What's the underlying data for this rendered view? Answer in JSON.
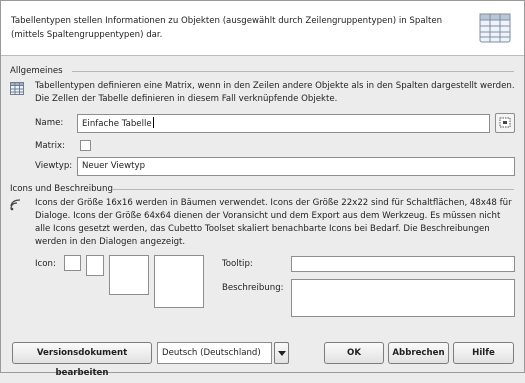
{
  "header": {
    "text": "Tabellentypen stellen Informationen zu Objekten (ausgewählt durch Zeilengruppentypen) in Spalten (mittels Spaltengruppentypen) dar."
  },
  "general": {
    "title": "Allgemeines",
    "description": "Tabellentypen definieren eine Matrix, wenn in den Zeilen andere Objekte als in den Spalten dargestellt werden. Die Zellen der Tabelle definieren in diesem Fall verknüpfende Objekte.",
    "name_label": "Name:",
    "name_value": "Einfache Tabelle",
    "matrix_label": "Matrix:",
    "viewtype_label": "Viewtyp:",
    "viewtype_value": "Neuer Viewtyp"
  },
  "icons": {
    "title": "Icons und Beschreibung",
    "description": "Icons der Größe 16x16 werden in Bäumen verwendet. Icons der Größe 22x22 sind für Schaltflächen, 48x48 für Dialoge. Icons der Größe 64x64 dienen der Voransicht und dem Export aus dem Werkzeug. Es müssen nicht alle Icons gesetzt werden, das Cubetto Toolset skaliert benachbarte Icons bei Bedarf. Die Beschreibungen werden in den Dialogen angezeigt.",
    "icon_label": "Icon:",
    "tooltip_label": "Tooltip:",
    "tooltip_value": "",
    "description_label": "Beschreibung:",
    "description_value": ""
  },
  "footer": {
    "edit_version_button": "Versionsdokument bearbeiten",
    "language_value": "Deutsch (Deutschland)",
    "ok_button": "OK",
    "cancel_button": "Abbrechen",
    "help_button": "Hilfe"
  }
}
